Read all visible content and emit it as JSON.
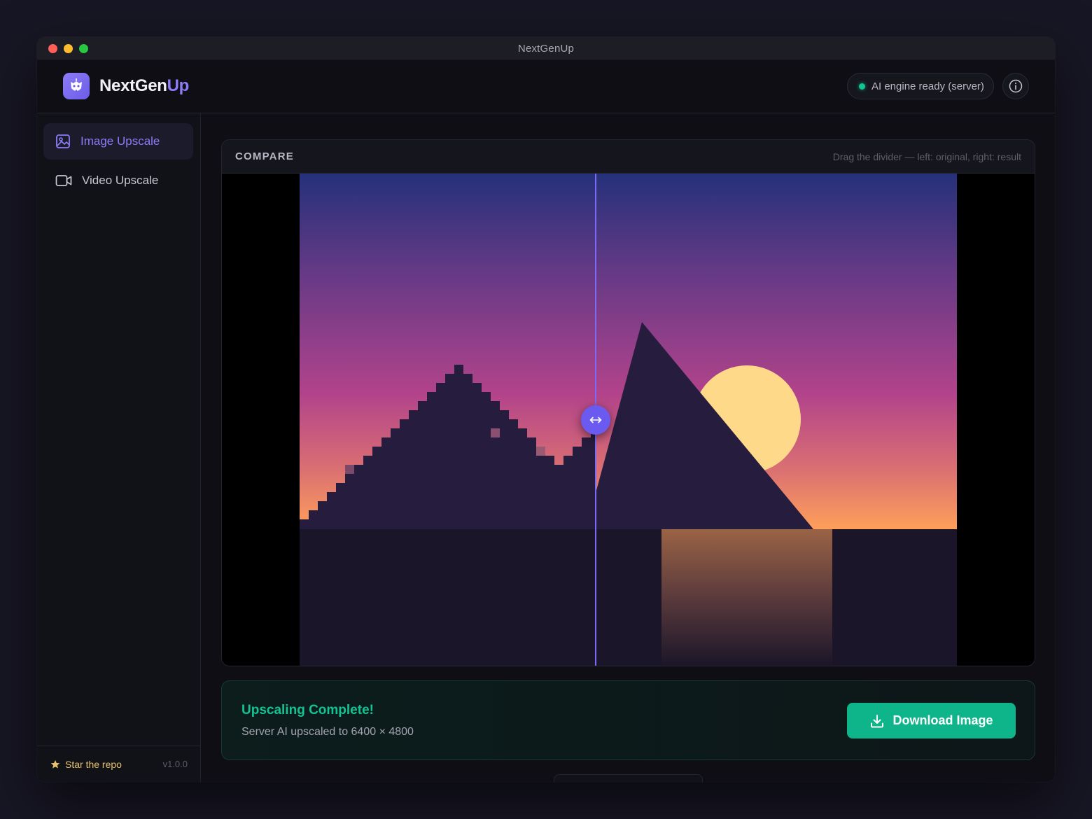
{
  "window": {
    "title": "NextGenUp"
  },
  "header": {
    "brand_part1": "NextGen",
    "brand_part2": "Up",
    "status_text": "AI engine ready (server)",
    "status_color": "#10c58f"
  },
  "sidebar": {
    "items": [
      {
        "label": "Image Upscale",
        "icon": "image-icon",
        "active": true
      },
      {
        "label": "Video Upscale",
        "icon": "video-icon",
        "active": false
      }
    ],
    "footer": {
      "star_label": "Star the repo",
      "version": "v1.0.0"
    }
  },
  "compare": {
    "title": "COMPARE",
    "hint": "Drag the divider — left: original, right: result",
    "divider_position_percent": 45,
    "divider_icon": "left-right-arrow-icon"
  },
  "result": {
    "title": "Upscaling Complete!",
    "subtitle": "Server AI upscaled to 6400 × 4800",
    "download_label": "Download Image",
    "accent": "#0fb58a"
  }
}
